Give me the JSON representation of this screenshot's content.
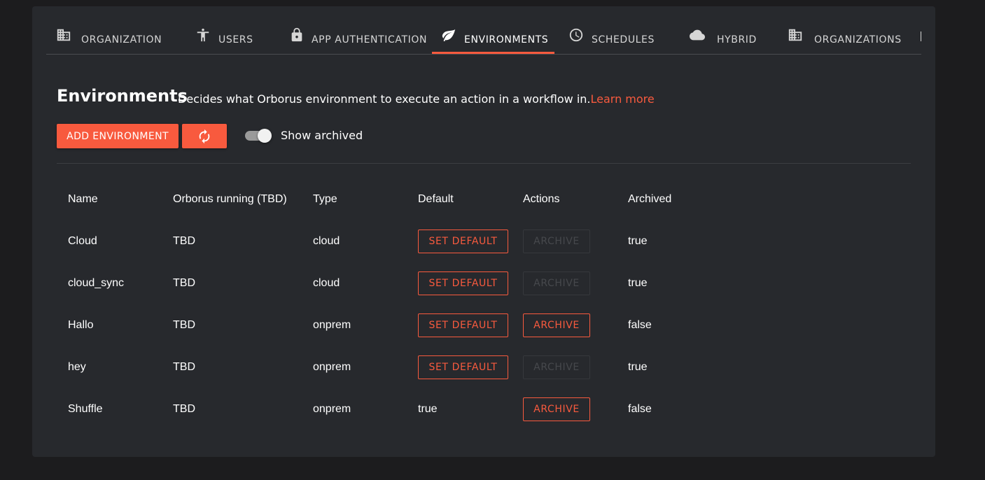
{
  "tabs": [
    {
      "label": "ORGANIZATION",
      "icon": "building-icon",
      "active": false
    },
    {
      "label": "USERS",
      "icon": "accessibility-icon",
      "active": false
    },
    {
      "label": "APP AUTHENTICATION",
      "icon": "lock-icon",
      "active": false
    },
    {
      "label": "ENVIRONMENTS",
      "icon": "leaf-icon",
      "active": true
    },
    {
      "label": "SCHEDULES",
      "icon": "clock-icon",
      "active": false
    },
    {
      "label": "HYBRID",
      "icon": "cloud-icon",
      "active": false
    },
    {
      "label": "ORGANIZATIONS",
      "icon": "building-icon",
      "active": false
    }
  ],
  "page": {
    "title": "Environments",
    "description": "Decides what Orborus environment to execute an action in a workflow in.",
    "learn_more": "Learn more"
  },
  "toolbar": {
    "add_label": "ADD ENVIRONMENT",
    "refresh_icon": "refresh-icon",
    "toggle_label": "Show archived",
    "toggle_on": true
  },
  "table": {
    "headers": [
      "Name",
      "Orborus running (TBD)",
      "Type",
      "Default",
      "Actions",
      "Archived"
    ],
    "rows": [
      {
        "name": "Cloud",
        "orborus": "TBD",
        "type": "cloud",
        "default_btn": "SET DEFAULT",
        "action": "ARCHIVE",
        "action_enabled": false,
        "archived": "true"
      },
      {
        "name": "cloud_sync",
        "orborus": "TBD",
        "type": "cloud",
        "default_btn": "SET DEFAULT",
        "action": "ARCHIVE",
        "action_enabled": false,
        "archived": "true"
      },
      {
        "name": "Hallo",
        "orborus": "TBD",
        "type": "onprem",
        "default_btn": "SET DEFAULT",
        "action": "ARCHIVE",
        "action_enabled": true,
        "archived": "false"
      },
      {
        "name": "hey",
        "orborus": "TBD",
        "type": "onprem",
        "default_btn": "SET DEFAULT",
        "action": "ARCHIVE",
        "action_enabled": false,
        "archived": "true"
      },
      {
        "name": "Shuffle",
        "orborus": "TBD",
        "type": "onprem",
        "default_text": "true",
        "action": "ARCHIVE",
        "action_enabled": true,
        "archived": "false"
      }
    ]
  },
  "colors": {
    "accent": "#f85a3e",
    "card": "#27292d",
    "background": "#1c1c1e"
  }
}
